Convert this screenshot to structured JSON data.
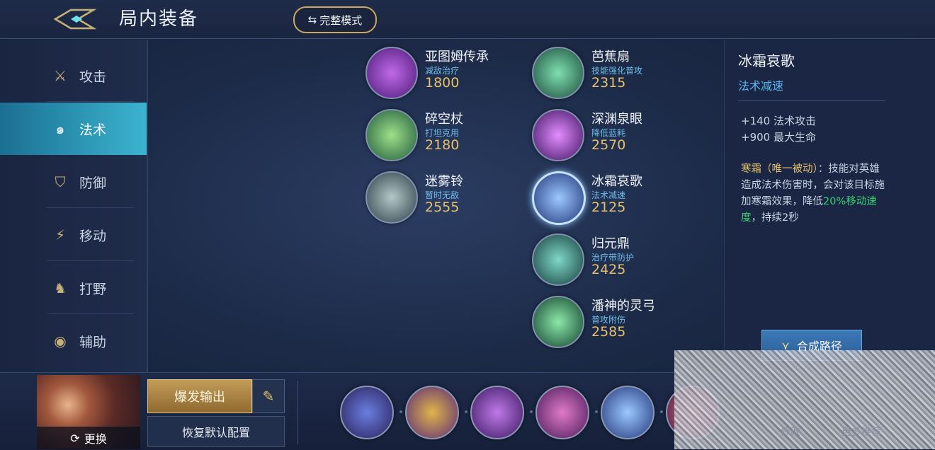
{
  "header": {
    "title": "局内装备",
    "mode_button": "完整模式"
  },
  "sidebar": {
    "items": [
      {
        "label": "攻击",
        "icon": "sword-icon"
      },
      {
        "label": "法术",
        "icon": "magic-swirl-icon"
      },
      {
        "label": "防御",
        "icon": "shield-icon"
      },
      {
        "label": "移动",
        "icon": "boot-icon"
      },
      {
        "label": "打野",
        "icon": "jungle-icon"
      },
      {
        "label": "辅助",
        "icon": "eye-icon"
      }
    ],
    "active": "法术"
  },
  "items": {
    "col1": [
      {
        "name": "亚图姆传承",
        "desc": "减敌治疗",
        "price": "1800",
        "color": "#7a2fb0"
      },
      {
        "name": "碎空杖",
        "desc": "打坦克用",
        "price": "2180",
        "color": "#2e7a4a"
      },
      {
        "name": "迷雾铃",
        "desc": "暂时无敌",
        "price": "2555",
        "color": "#3a5e64"
      }
    ],
    "col2": [
      {
        "name": "芭蕉扇",
        "desc": "技能强化普攻",
        "price": "2315",
        "color": "#2c7a5e"
      },
      {
        "name": "深渊泉眼",
        "desc": "降低蓝耗",
        "price": "2570",
        "color": "#7b2ab0"
      },
      {
        "name": "冰霜哀歌",
        "desc": "法术减速",
        "price": "2125",
        "color": "#2b4fa0"
      },
      {
        "name": "归元鼎",
        "desc": "治疗带防护",
        "price": "2425",
        "color": "#1f6a64"
      },
      {
        "name": "潘神的灵弓",
        "desc": "普攻附伤",
        "price": "2585",
        "color": "#1d6a54"
      }
    ]
  },
  "detail": {
    "name": "冰霜哀歌",
    "subtitle": "法术减速",
    "stat1": "+140 法术攻击",
    "stat2": "+900 最大生命",
    "passive_title": "寒霜（唯一被动）",
    "passive_text": "：技能对英雄造成法术伤害时，会对该目标施加寒霜效果，降低",
    "passive_highlight": "20%移动速度",
    "passive_tail": "，持续2秒",
    "craft_button": "合成路径"
  },
  "bottom": {
    "swap_label": "更换",
    "build_name": "爆发输出",
    "reset_label": "恢复默认配置",
    "obscured_left": "修改",
    "obscured_right": "更多推荐"
  }
}
